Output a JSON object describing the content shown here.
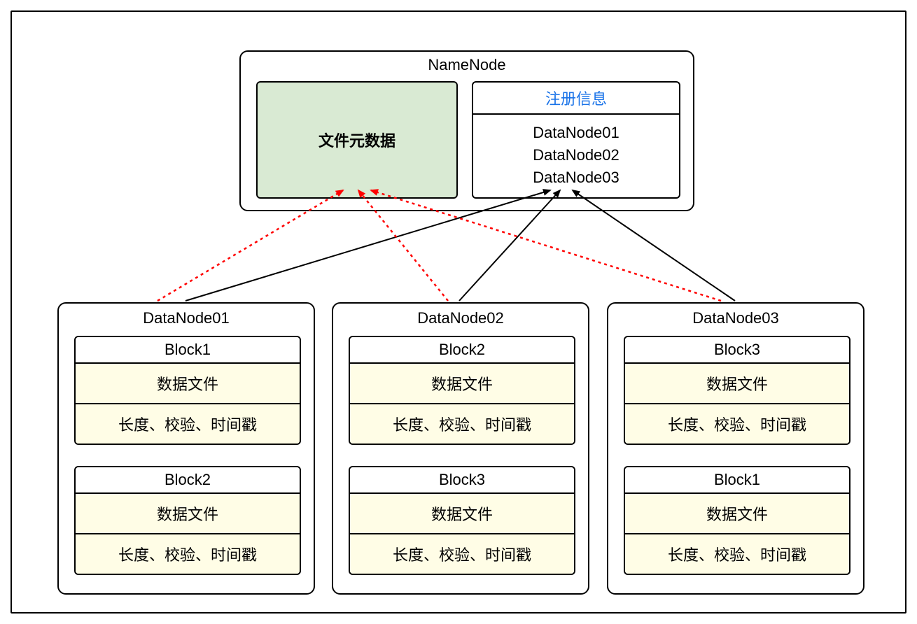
{
  "namenode": {
    "title": "NameNode",
    "metadata_label": "文件元数据",
    "reginfo_title": "注册信息",
    "reginfo_items": [
      "DataNode01",
      "DataNode02",
      "DataNode03"
    ]
  },
  "datanodes": [
    {
      "title": "DataNode01",
      "blocks": [
        {
          "name": "Block1",
          "row1": "数据文件",
          "row2": "长度、校验、时间戳"
        },
        {
          "name": "Block2",
          "row1": "数据文件",
          "row2": "长度、校验、时间戳"
        }
      ]
    },
    {
      "title": "DataNode02",
      "blocks": [
        {
          "name": "Block2",
          "row1": "数据文件",
          "row2": "长度、校验、时间戳"
        },
        {
          "name": "Block3",
          "row1": "数据文件",
          "row2": "长度、校验、时间戳"
        }
      ]
    },
    {
      "title": "DataNode03",
      "blocks": [
        {
          "name": "Block3",
          "row1": "数据文件",
          "row2": "长度、校验、时间戳"
        },
        {
          "name": "Block1",
          "row1": "数据文件",
          "row2": "长度、校验、时间戳"
        }
      ]
    }
  ],
  "colors": {
    "metadata_bg": "#d9ead3",
    "block_bg": "#fffde6",
    "reginfo_title_color": "#1a73e8",
    "dotted_arrow": "#ff0000",
    "solid_arrow": "#000000"
  }
}
